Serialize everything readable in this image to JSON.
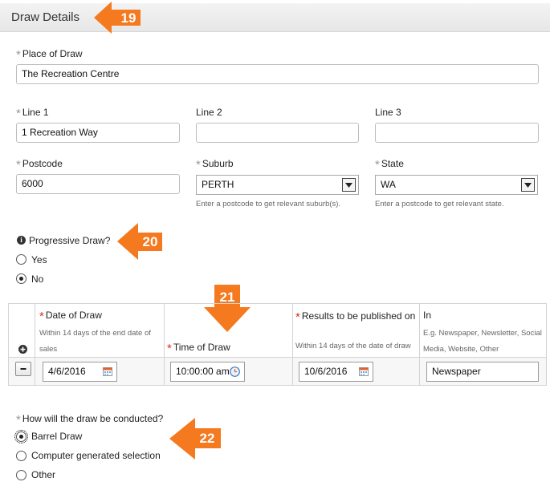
{
  "header": {
    "title": "Draw Details"
  },
  "callouts": [
    "19",
    "20",
    "21",
    "22"
  ],
  "place": {
    "label": "Place of Draw",
    "value": "The Recreation Centre"
  },
  "address": {
    "line1": {
      "label": "Line 1",
      "value": "1 Recreation Way"
    },
    "line2": {
      "label": "Line 2",
      "value": ""
    },
    "line3": {
      "label": "Line 3",
      "value": ""
    }
  },
  "postcode": {
    "label": "Postcode",
    "value": "6000"
  },
  "suburb": {
    "label": "Suburb",
    "value": "PERTH",
    "hint": "Enter a postcode to get relevant suburb(s)."
  },
  "state": {
    "label": "State",
    "value": "WA",
    "hint": "Enter a postcode to get relevant state."
  },
  "progressive": {
    "label": "Progressive Draw?",
    "options": [
      "Yes",
      "No"
    ],
    "selected": "No"
  },
  "table": {
    "date_of_draw": {
      "label": "Date of Draw",
      "hint": "Within 14 days of the end date of sales",
      "value": "4/6/2016"
    },
    "time_of_draw": {
      "label": "Time of Draw",
      "value": "10:00:00 am"
    },
    "results": {
      "label": "Results to be published on",
      "hint": "Within 14 days of the date of draw",
      "value": "10/6/2016"
    },
    "in": {
      "label": "In",
      "hint": "E.g. Newspaper, Newsletter, Social Media, Website, Other",
      "value": "Newspaper"
    }
  },
  "conducted": {
    "label": "How will the draw be conducted?",
    "options": [
      "Barrel Draw",
      "Computer generated selection",
      "Other"
    ],
    "selected": "Barrel Draw"
  },
  "colors": {
    "callout": "#f4791f",
    "required_star": "#e0301e"
  },
  "icons": [
    "info-icon",
    "plus-icon",
    "minus-icon",
    "calendar-icon",
    "clock-icon",
    "chevron-down-icon",
    "arrow-callout-icon"
  ]
}
